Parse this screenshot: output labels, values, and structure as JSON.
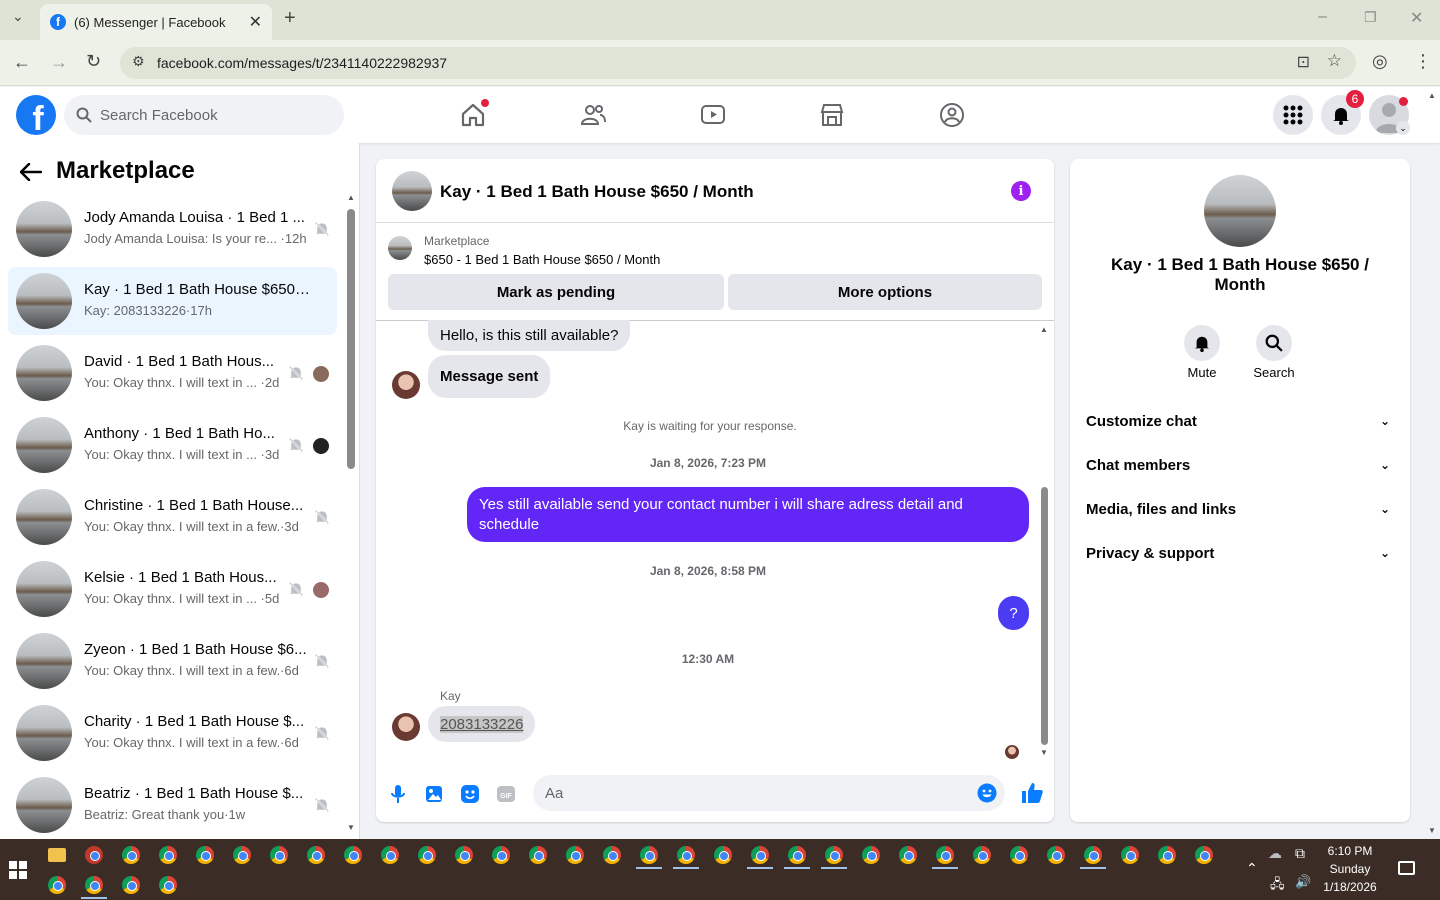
{
  "browser": {
    "tab_title": "(6) Messenger | Facebook",
    "url": "facebook.com/messages/t/2341140222982937"
  },
  "fb": {
    "search_placeholder": "Search Facebook",
    "notifications_count": "6"
  },
  "sidebar": {
    "title": "Marketplace",
    "conversations": [
      {
        "name": "Jody Amanda Louisa · 1 Bed 1 ...",
        "snippet": "Jody Amanda Louisa: Is your re... ·12h"
      },
      {
        "name": "Kay · 1 Bed 1 Bath House $650 / ...",
        "snippet": "Kay: 2083133226·17h"
      },
      {
        "name": "David · 1 Bed 1 Bath Hous...",
        "snippet": "You: Okay thnx. I will text in ... ·2d"
      },
      {
        "name": "Anthony · 1 Bed 1 Bath Ho...",
        "snippet": "You: Okay thnx. I will text in ... ·3d"
      },
      {
        "name": "Christine · 1 Bed 1 Bath House...",
        "snippet": "You: Okay thnx. I will text in a few.·3d"
      },
      {
        "name": "Kelsie · 1 Bed 1 Bath Hous...",
        "snippet": "You: Okay thnx. I will text in ... ·5d"
      },
      {
        "name": "Zyeon · 1 Bed 1 Bath House $6...",
        "snippet": "You: Okay thnx. I will text in a few.·6d"
      },
      {
        "name": "Charity · 1 Bed 1 Bath House $...",
        "snippet": "You: Okay thnx. I will text in a few.·6d"
      },
      {
        "name": "Beatriz · 1 Bed 1 Bath House $...",
        "snippet": "Beatriz: Great thank you·1w"
      }
    ]
  },
  "chat": {
    "title": "Kay · 1 Bed 1 Bath House $650 / Month",
    "marketplace_label": "Marketplace",
    "listing": "$650 - 1 Bed 1 Bath House $650 / Month",
    "mark_pending": "Mark as pending",
    "more_options": "More options",
    "messages": {
      "m1": "Hello, is this still available?",
      "m2": "Message sent",
      "waiting": "Kay is waiting for your response.",
      "ts1": "Jan 8, 2026, 7:23 PM",
      "out1": "Yes still available send your contact number i will share adress detail and schedule",
      "ts2": "Jan 8, 2026, 8:58 PM",
      "out2": "?",
      "ts3": "12:30 AM",
      "sender": "Kay",
      "in3": "2083133226"
    },
    "composer_placeholder": "Aa"
  },
  "details": {
    "title": "Kay · 1 Bed 1 Bath House $650 / Month",
    "mute": "Mute",
    "search": "Search",
    "sections": [
      "Customize chat",
      "Chat members",
      "Media, files and links",
      "Privacy & support"
    ]
  },
  "taskbar": {
    "time": "6:10 PM",
    "day": "Sunday",
    "date": "1/18/2026"
  },
  "colors": {
    "fb_blue": "#1877f2",
    "outgoing_bubble": "#6226f7",
    "accent_purple": "#a020f0"
  }
}
